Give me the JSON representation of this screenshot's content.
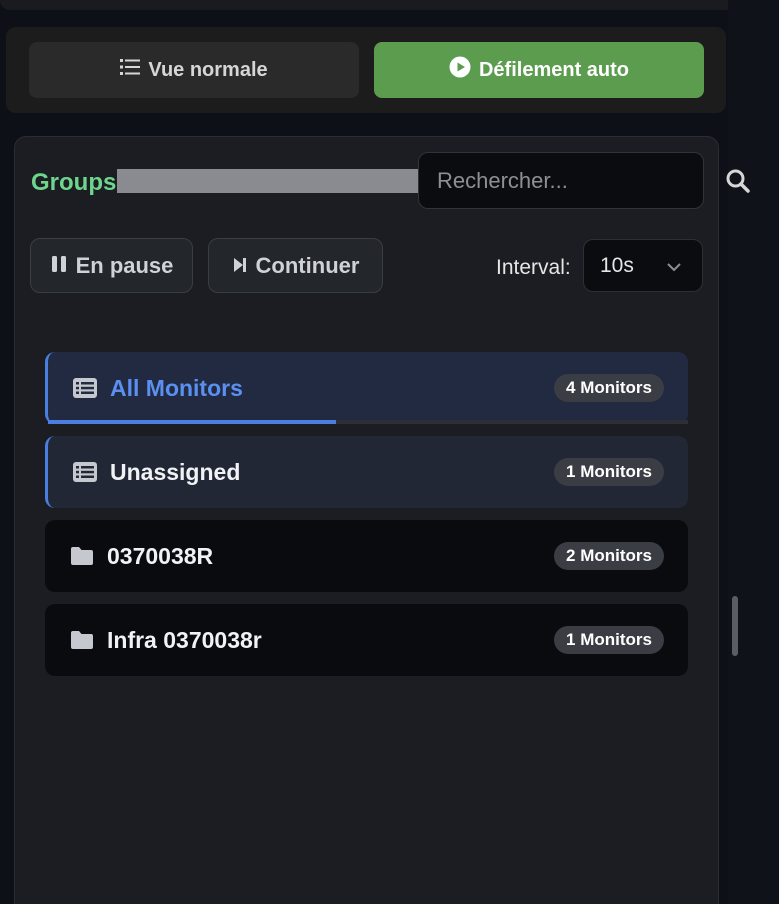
{
  "view_modes": {
    "normal_label": "Vue normale",
    "auto_label": "Défilement auto"
  },
  "groups_panel": {
    "title": "Groups",
    "search_placeholder": "Rechercher...",
    "pause_label": "En pause",
    "continue_label": "Continuer",
    "interval_label": "Interval:",
    "interval_value": "10s",
    "progress_percent": 45,
    "items": [
      {
        "name": "All Monitors",
        "count": "4 Monitors",
        "icon": "list-icon"
      },
      {
        "name": "Unassigned",
        "count": "1 Monitors",
        "icon": "list-icon"
      },
      {
        "name": "0370038R",
        "count": "2 Monitors",
        "icon": "folder-icon"
      },
      {
        "name": "Infra 0370038r",
        "count": "1 Monitors",
        "icon": "folder-icon"
      }
    ]
  },
  "colors": {
    "accent_green": "#5b9c4e",
    "title_green": "#6dd58c",
    "active_blue": "#4a7fe0"
  }
}
